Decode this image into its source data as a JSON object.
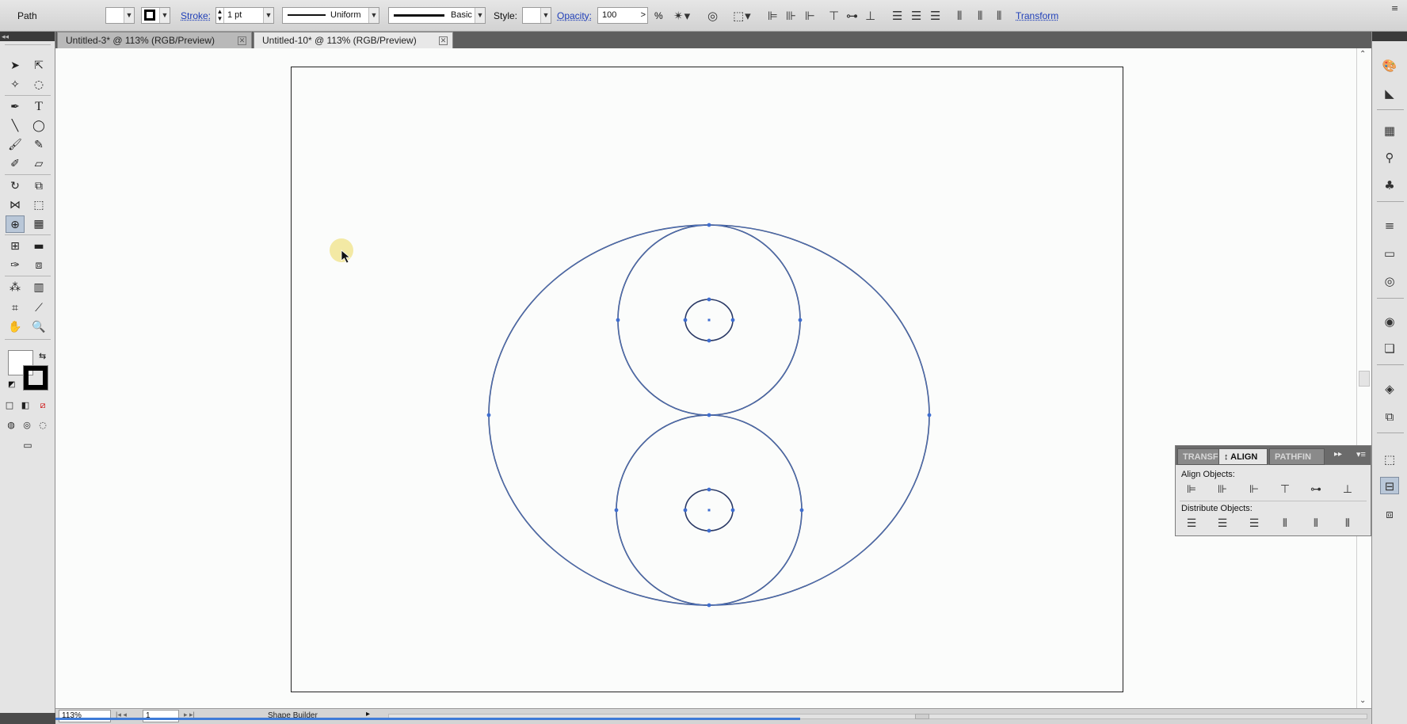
{
  "control_bar": {
    "selection_type": "Path",
    "stroke_label": "Stroke:",
    "stroke_weight": "1 pt",
    "variable_width_profile": "Uniform",
    "brush_definition": "Basic",
    "style_label": "Style:",
    "opacity_label": "Opacity:",
    "opacity_value": "100",
    "opacity_unit": "%",
    "transform_link": "Transform"
  },
  "tabs": [
    {
      "label": "Untitled-3* @ 113% (RGB/Preview)",
      "active": false
    },
    {
      "label": "Untitled-10* @ 113% (RGB/Preview)",
      "active": true
    }
  ],
  "tools": {
    "selected": "shape-builder-tool"
  },
  "align_panel": {
    "tabs": [
      "TRANSF",
      "↕ ALIGN",
      "PATHFIN"
    ],
    "active_tab": "ALIGN",
    "align_objects_label": "Align Objects:",
    "distribute_objects_label": "Distribute Objects:"
  },
  "status_bar": {
    "zoom": "113%",
    "artboard_number": "1",
    "current_tool": "Shape Builder"
  },
  "colors": {
    "path_stroke": "#2b3a66",
    "anchor_blue": "#3f6ed1",
    "highlight": "#f2e79a",
    "selected_tool": "#b9c7d8"
  }
}
